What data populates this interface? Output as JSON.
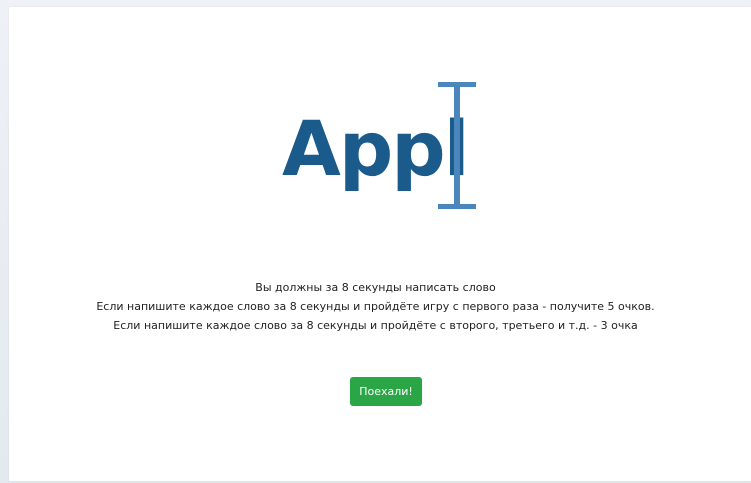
{
  "logo": {
    "text": "Appl",
    "color": "#1b5b8c",
    "cursor_color": "#4b86bd",
    "icon": "text-cursor-icon"
  },
  "instructions": {
    "line1": "Вы должны за 8 секунды написать слово",
    "line2": "Если напишите каждое слово за 8 секунды и пройдёте игру с первого раза - получите 5 очков.",
    "line3": "Если напишите каждое слово за 8 секунды и пройдёте с второго, третьего и т.д. - 3 очка"
  },
  "start_button": {
    "label": "Поехали!",
    "color": "#2aa646"
  }
}
